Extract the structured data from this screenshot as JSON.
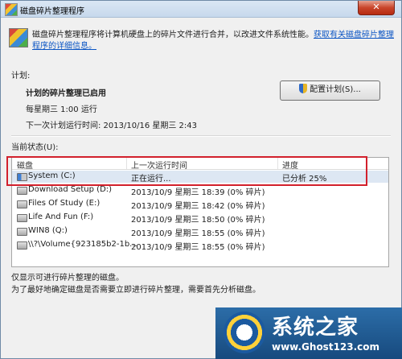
{
  "window": {
    "title": "磁盘碎片整理程序",
    "close_glyph": "✕"
  },
  "intro": {
    "text": "磁盘碎片整理程序将计算机硬盘上的碎片文件进行合并，以改进文件系统性能。",
    "link": "获取有关磁盘碎片整理程序的详细信息。"
  },
  "schedule": {
    "section_label": "计划:",
    "status": "计划的碎片整理已启用",
    "frequency": "每星期三 1:00 运行",
    "next_run": "下一次计划运行时间: 2013/10/16 星期三 2:43",
    "configure_button": "配置计划(S)..."
  },
  "current_status": {
    "section_label": "当前状态(U):",
    "columns": [
      "磁盘",
      "上一次运行时间",
      "进度"
    ],
    "rows": [
      {
        "disk": "System (C:)",
        "last_run": "正在运行...",
        "progress": "已分析 25%"
      },
      {
        "disk": "Download Setup (D:)",
        "last_run": "2013/10/9 星期三 18:39 (0% 碎片)",
        "progress": ""
      },
      {
        "disk": "Files Of Study (E:)",
        "last_run": "2013/10/9 星期三 18:42 (0% 碎片)",
        "progress": ""
      },
      {
        "disk": "Life And Fun (F:)",
        "last_run": "2013/10/9 星期三 18:50 (0% 碎片)",
        "progress": ""
      },
      {
        "disk": "WIN8 (Q:)",
        "last_run": "2013/10/9 星期三 18:55 (0% 碎片)",
        "progress": ""
      },
      {
        "disk": "\\\\?\\Volume{923185b2-1b...",
        "last_run": "2013/10/9 星期三 18:55 (0% 碎片)",
        "progress": ""
      }
    ]
  },
  "footer": {
    "line1": "仅显示可进行碎片整理的磁盘。",
    "line2": "为了最好地确定磁盘是否需要立即进行碎片整理，需要首先分析磁盘。"
  },
  "watermark": {
    "title": "系统之家",
    "url": "www.Ghost123.com"
  },
  "colors": {
    "highlight": "#d2202c",
    "link": "#0b55c4",
    "selected_row": "#dde7f3"
  }
}
